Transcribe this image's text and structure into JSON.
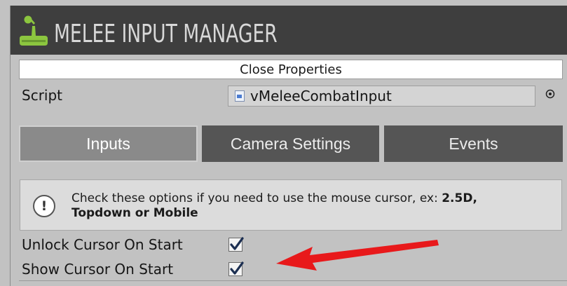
{
  "header": {
    "title": "MELEE INPUT MANAGER",
    "logo_icon": "joystick-icon"
  },
  "close_bar": {
    "label": "Close Properties"
  },
  "script": {
    "label": "Script",
    "value": "vMeleeCombatInput",
    "file_icon": "cs-script-icon",
    "picker_icon": "object-picker-icon"
  },
  "tabs": [
    {
      "label": "Inputs",
      "active": true
    },
    {
      "label": "Camera Settings",
      "active": false
    },
    {
      "label": "Events",
      "active": false
    }
  ],
  "help": {
    "icon": "info-icon",
    "text_prefix": "Check these options if you need to use the mouse cursor, ex: ",
    "text_bold_1": "2.5D,",
    "text_bold_2": "Topdown or Mobile"
  },
  "options": [
    {
      "label": "Unlock Cursor On Start",
      "checked": true
    },
    {
      "label": "Show Cursor On Start",
      "checked": true
    }
  ],
  "colors": {
    "annotation_arrow": "#e8191b",
    "header_bg": "#3e3e3e",
    "tab_inactive": "#555555"
  }
}
